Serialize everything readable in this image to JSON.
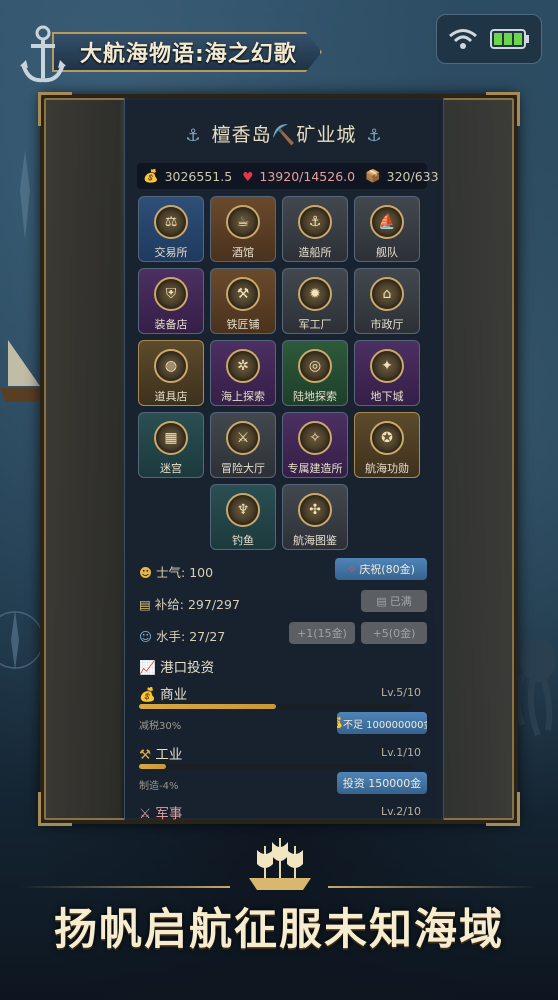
{
  "app": {
    "title": "大航海物语:海之幻歌",
    "slogan": "扬帆启航征服未知海域"
  },
  "status": {
    "wifi_icon": "wifi-icon",
    "battery_icon": "battery-icon",
    "battery_level": 1.0
  },
  "town": {
    "title": "檀香岛⛏️矿业城",
    "anchor_glyph": "⚓"
  },
  "resources": {
    "gold": "3026551.5",
    "health": "13920/14526.0",
    "cargo": "320/633"
  },
  "buildings": [
    {
      "label": "交易所",
      "icon": "scales-icon",
      "style": "blue"
    },
    {
      "label": "酒馆",
      "icon": "tavern-icon",
      "style": "brown"
    },
    {
      "label": "造船所",
      "icon": "shipyard-icon",
      "style": "gray"
    },
    {
      "label": "舰队",
      "icon": "fleet-icon",
      "style": "gray"
    },
    {
      "label": "装备店",
      "icon": "armor-icon",
      "style": "purple"
    },
    {
      "label": "铁匠铺",
      "icon": "anvil-icon",
      "style": "brown"
    },
    {
      "label": "军工厂",
      "icon": "cannon-icon",
      "style": "gray"
    },
    {
      "label": "市政厅",
      "icon": "hall-icon",
      "style": "gray"
    },
    {
      "label": "道具店",
      "icon": "bag-icon",
      "style": "gold"
    },
    {
      "label": "海上探索",
      "icon": "wheel-icon",
      "style": "purple"
    },
    {
      "label": "陆地探索",
      "icon": "globe-icon",
      "style": "green"
    },
    {
      "label": "地下城",
      "icon": "dungeon-icon",
      "style": "purple"
    },
    {
      "label": "迷宫",
      "icon": "maze-icon",
      "style": "teal"
    },
    {
      "label": "冒险大厅",
      "icon": "adventure-icon",
      "style": "gray"
    },
    {
      "label": "专属建造所",
      "icon": "forge-icon",
      "style": "purple"
    },
    {
      "label": "航海功勋",
      "icon": "medal-icon",
      "style": "gold"
    },
    {
      "label": "钓鱼",
      "icon": "fishing-icon",
      "style": "teal"
    },
    {
      "label": "航海图鉴",
      "icon": "compass-icon",
      "style": "gray"
    }
  ],
  "morale": {
    "label": "士气: 100",
    "button": "庆祝(80金)"
  },
  "supply": {
    "label": "补给: 297/297",
    "button": "已满"
  },
  "sailors": {
    "label": "水手: 27/27",
    "button_1": "+1(15金)",
    "button_5": "+5(0金)"
  },
  "investment": {
    "title": "港口投资",
    "sections": [
      {
        "name": "商业",
        "level": "Lv.5/10",
        "progress": 0.5,
        "note": "减税30%",
        "button": "不足 100000000金",
        "button_state": "insufficient"
      },
      {
        "name": "工业",
        "level": "Lv.1/10",
        "progress": 0.1,
        "note": "制造-4%",
        "button": "投资 150000金",
        "button_state": "active"
      },
      {
        "name": "军事",
        "level": "Lv.2/10"
      }
    ]
  }
}
